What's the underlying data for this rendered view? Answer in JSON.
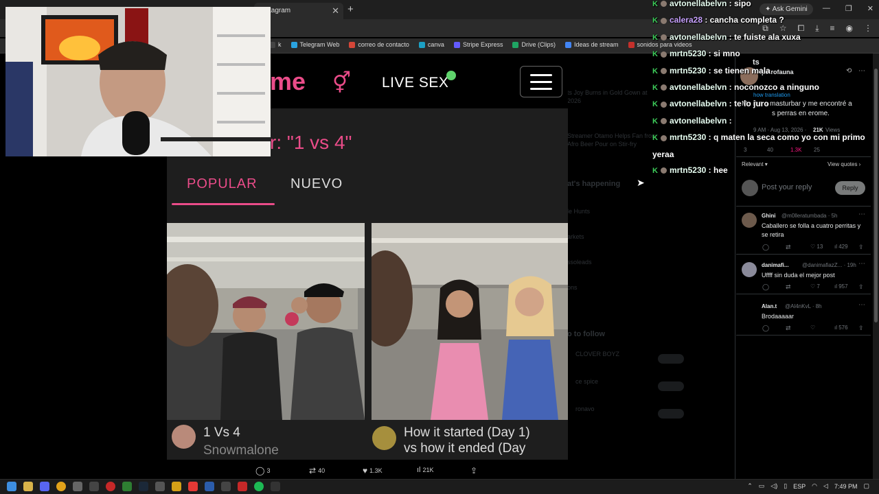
{
  "browser": {
    "active_tab_title": "tagram",
    "ask_gemini": "Ask Gemini",
    "bookmarks": [
      {
        "label": "k",
        "color": "#444444"
      },
      {
        "label": "Telegram Web",
        "color": "#2aa3e0"
      },
      {
        "label": "correo de contacto",
        "color": "#d44638"
      },
      {
        "label": "canva",
        "color": "#1ca0c4"
      },
      {
        "label": "Stripe Express",
        "color": "#635bff"
      },
      {
        "label": "Drive (Clips)",
        "color": "#1fa463"
      },
      {
        "label": "Ideas de stream",
        "color": "#4285f4"
      },
      {
        "label": "sonidos para videos",
        "color": "#c4302b"
      }
    ]
  },
  "erome": {
    "logo": "me",
    "live_sex": "LIVE SEX",
    "search_title": "r: \"1 vs 4\"",
    "tabs": {
      "popular": "POPULAR",
      "nuevo": "NUEVO"
    },
    "cards": [
      {
        "title": "1 Vs 4",
        "author": "Snowmalone"
      },
      {
        "title_line1": "How it started (Day 1)",
        "title_line2": "vs how it ended (Day"
      }
    ]
  },
  "tweet_bar": {
    "replies": "3",
    "retweets": "40",
    "likes": "1.3K",
    "views": "21K"
  },
  "chat": [
    {
      "user": "avtonellabelvn",
      "msg": "sipo"
    },
    {
      "user": "calera28",
      "msg": "cancha completa ?",
      "color": "#c8a2ff"
    },
    {
      "user": "avtonellabelvn",
      "msg": "te fuiste ala xuxa"
    },
    {
      "user": "mrtn5230",
      "msg": "si mno"
    },
    {
      "user": "mrtn5230",
      "msg": "se tienen mala"
    },
    {
      "user": "avtonellabelvn",
      "msg": "noconozco a ninguno"
    },
    {
      "user": "avtonellabelvn",
      "msg": "te lo juro"
    },
    {
      "user": "avtonellabelvn",
      "msg": ""
    },
    {
      "user": "mrtn5230",
      "msg": "q maten la seca como yo con mi primo"
    },
    {
      "user": "",
      "msg": "yeraa"
    },
    {
      "user": "mrtn5230",
      "msg": "hee"
    }
  ],
  "twitter": {
    "top_fragment": "ts",
    "poster": "petrofauna",
    "show_translation": "how translation",
    "post_text_line1": "Me iba a masturbar y me encontré a",
    "post_text_line2": "s perras en erome.",
    "timestamp": "9 AM · Aug 13, 2026 ·",
    "views_count": "21K",
    "views_label": "Views",
    "stats": {
      "replies": "3",
      "retweets": "40",
      "likes": "1.3K",
      "bookmarks": "25"
    },
    "sort": "Relevant",
    "view_quotes": "View quotes",
    "reply_placeholder": "Post your reply",
    "reply_button": "Reply",
    "replies": [
      {
        "name": "Ghini",
        "handle": "@m0lleratumbada · 5h",
        "text_line1": "Caballero se folla a cuatro perritas y",
        "text_line2": "se retira",
        "retweets": "",
        "likes": "13",
        "views": "429"
      },
      {
        "name": "danimafi...",
        "handle": "@danimafiazZ... · 19h",
        "text_line1": "Uffff sin duda el mejor post",
        "text_line2": "",
        "retweets": "",
        "likes": "7",
        "views": "957"
      },
      {
        "name": "Alan.t",
        "handle": "@Al4nKvL · 8h",
        "text_line1": "Brodaaaaar",
        "text_line2": "",
        "retweets": "",
        "likes": "",
        "views": "576"
      }
    ],
    "background": {
      "item1_line1": "ts Joy Burns in Gold Gown at",
      "item1_line2": "2026",
      "item2_line1": "Streamer Otamo Helps Fan from",
      "item2_line2": "Afro Beer Pour on Stir-fry",
      "whats_happening": "at's happening",
      "item3": "le Hunts",
      "item4": "arkets",
      "item5": "ssoleads",
      "item6": "ons",
      "who_to_follow": "o to follow",
      "follow1": "CLOVER BOYZ",
      "follow2": "ce spice",
      "follow3": "ronavo",
      "follow_btn": "Follow"
    }
  },
  "taskbar": {
    "lang": "ESP",
    "time": "7:49 PM"
  }
}
